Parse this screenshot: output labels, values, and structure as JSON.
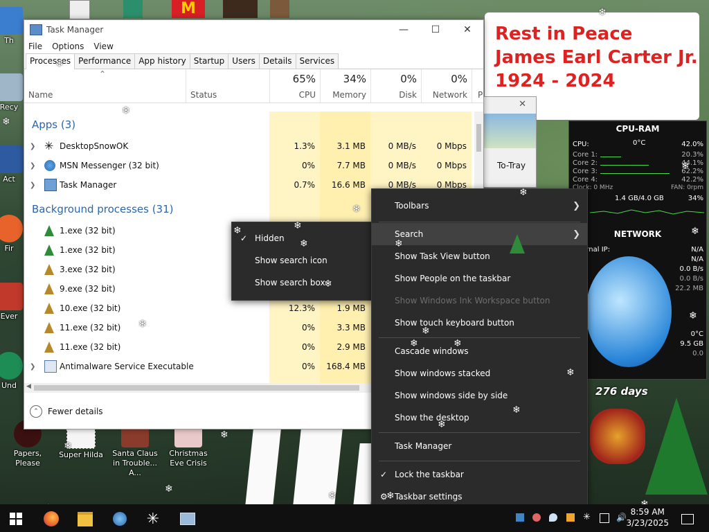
{
  "task_manager": {
    "title": "Task Manager",
    "window_controls": {
      "minimize": "—",
      "maximize": "☐",
      "close": "✕"
    },
    "menu": [
      "File",
      "Options",
      "View"
    ],
    "tabs": [
      "Processes",
      "Performance",
      "App history",
      "Startup",
      "Users",
      "Details",
      "Services"
    ],
    "active_tab": "Processes",
    "columns": {
      "name": "Name",
      "status": "Status",
      "cpu": {
        "label": "CPU",
        "pct": "65%"
      },
      "memory": {
        "label": "Memory",
        "pct": "34%"
      },
      "disk": {
        "label": "Disk",
        "pct": "0%"
      },
      "network": {
        "label": "Network",
        "pct": "0%"
      },
      "power": "P"
    },
    "groups": {
      "apps": "Apps (3)",
      "background": "Background processes (31)"
    },
    "apps": [
      {
        "name": "DesktopSnowOK",
        "cpu": "1.3%",
        "memory": "3.1 MB",
        "disk": "0 MB/s",
        "network": "0 Mbps"
      },
      {
        "name": "MSN Messenger (32 bit)",
        "cpu": "0%",
        "memory": "7.7 MB",
        "disk": "0 MB/s",
        "network": "0 Mbps"
      },
      {
        "name": "Task Manager",
        "cpu": "0.7%",
        "memory": "16.6 MB",
        "disk": "0 MB/s",
        "network": "0 Mbps"
      }
    ],
    "background": [
      {
        "name": "1.exe (32 bit)",
        "cpu": "",
        "memory": ""
      },
      {
        "name": "1.exe (32 bit)",
        "cpu": "",
        "memory": ""
      },
      {
        "name": "3.exe (32 bit)",
        "cpu": "",
        "memory": ""
      },
      {
        "name": "9.exe (32 bit)",
        "cpu": "",
        "memory": ""
      },
      {
        "name": "10.exe (32 bit)",
        "cpu": "12.3%",
        "memory": "1.9 MB"
      },
      {
        "name": "11.exe (32 bit)",
        "cpu": "0%",
        "memory": "3.3 MB"
      },
      {
        "name": "11.exe (32 bit)",
        "cpu": "0%",
        "memory": "2.9 MB"
      },
      {
        "name": "Antimalware Service Executable",
        "cpu": "0%",
        "memory": "168.4 MB"
      }
    ],
    "footer": "Fewer details"
  },
  "search_submenu": {
    "items": [
      {
        "label": "Hidden",
        "checked": true
      },
      {
        "label": "Show search icon",
        "checked": false
      },
      {
        "label": "Show search box",
        "checked": false
      }
    ]
  },
  "taskbar_menu": {
    "toolbars": "Toolbars",
    "search": "Search",
    "show_task_view": "Show Task View button",
    "show_people": "Show People on the taskbar",
    "show_ink": "Show Windows Ink Workspace button",
    "show_touch_keyboard": "Show touch keyboard button",
    "cascade": "Cascade windows",
    "stacked": "Show windows stacked",
    "side_by_side": "Show windows side by side",
    "show_desktop": "Show the desktop",
    "task_manager": "Task Manager",
    "lock_taskbar": "Lock the taskbar",
    "taskbar_settings": "Taskbar settings"
  },
  "banner": {
    "line1": "Rest in Peace",
    "line2": "James Earl Carter Jr.",
    "line3": "1924 - 2024"
  },
  "small_window": {
    "button": "To-Tray",
    "close": "✕"
  },
  "gadget": {
    "cpu_ram_title": "CPU-RAM",
    "cpu_label": "CPU:",
    "cpu_temp": "0°C",
    "cpu_value": "42.0%",
    "cores": [
      {
        "label": "Core 1:",
        "value": "20.3%"
      },
      {
        "label": "Core 2:",
        "value": "44.1%"
      },
      {
        "label": "Core 3:",
        "value": "62.2%"
      },
      {
        "label": "Core 4:",
        "value": "42.2%"
      }
    ],
    "clock_label": "Clock: 0 MHz",
    "fan_label": "FAN: 0rpm",
    "ram_value": "1.4 GB/4.0 GB",
    "ram_pct": "34%",
    "network_title": "NETWORK",
    "ip_label": "Internal IP:",
    "ip_values": [
      "N/A",
      "N/A"
    ],
    "net_values": [
      "0.0 B/s",
      "0.0 B/s",
      "22.2 MB"
    ],
    "extra_values": [
      "0°C",
      "9.5 GB",
      "0.0"
    ],
    "days_label": "276 days"
  },
  "desktop_icons": [
    {
      "label": "Papers, Please"
    },
    {
      "label": "Super Hilda"
    },
    {
      "label": "Santa Claus in Trouble... A..."
    },
    {
      "label": "Christmas Eve Crisis"
    }
  ],
  "desktop_side_labels": [
    "Th",
    "Recy",
    "Act",
    "Fir",
    "Ever",
    "Und"
  ],
  "clock": {
    "time": "8:59 AM",
    "date": "3/23/2025"
  },
  "colors": {
    "accent": "#2a66b0",
    "heat_yellow": "#fff4c4",
    "menu_bg": "#2b2b2b",
    "banner_red": "#d22222"
  }
}
